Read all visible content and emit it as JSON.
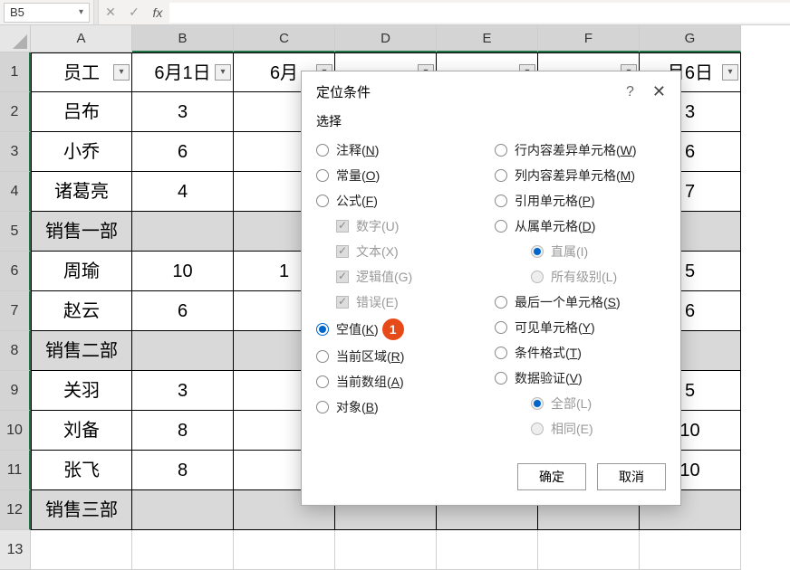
{
  "formula_bar": {
    "name_box": "B5",
    "cancel_glyph": "✕",
    "enter_glyph": "✓",
    "fx_glyph": "fx"
  },
  "columns": [
    "A",
    "B",
    "C",
    "D",
    "E",
    "F",
    "G"
  ],
  "row_headers": [
    "1",
    "2",
    "3",
    "4",
    "5",
    "6",
    "7",
    "8",
    "9",
    "10",
    "11",
    "12",
    "13"
  ],
  "selected_cols_start": 1,
  "selected_cols_end": 6,
  "rows": [
    {
      "h": "1",
      "A": "员工",
      "B": "6月1日",
      "C": "6月",
      "D": "",
      "E": "",
      "F": "",
      "G": "月6日",
      "grey": false,
      "dd": true
    },
    {
      "h": "2",
      "A": "吕布",
      "B": "3",
      "C": "",
      "D": "",
      "E": "",
      "F": "",
      "G": "3",
      "grey": false
    },
    {
      "h": "3",
      "A": "小乔",
      "B": "6",
      "C": "",
      "D": "",
      "E": "",
      "F": "",
      "G": "6",
      "grey": false
    },
    {
      "h": "4",
      "A": "诸葛亮",
      "B": "4",
      "C": "",
      "D": "",
      "E": "",
      "F": "",
      "G": "7",
      "grey": false
    },
    {
      "h": "5",
      "A": "销售一部",
      "B": "",
      "C": "",
      "D": "",
      "E": "",
      "F": "",
      "G": "",
      "grey": true
    },
    {
      "h": "6",
      "A": "周瑜",
      "B": "10",
      "C": "1",
      "D": "",
      "E": "",
      "F": "",
      "G": "5",
      "grey": false
    },
    {
      "h": "7",
      "A": "赵云",
      "B": "6",
      "C": "",
      "D": "",
      "E": "",
      "F": "",
      "G": "6",
      "grey": false
    },
    {
      "h": "8",
      "A": "销售二部",
      "B": "",
      "C": "",
      "D": "",
      "E": "",
      "F": "",
      "G": "",
      "grey": true
    },
    {
      "h": "9",
      "A": "关羽",
      "B": "3",
      "C": "",
      "D": "",
      "E": "",
      "F": "",
      "G": "5",
      "grey": false
    },
    {
      "h": "10",
      "A": "刘备",
      "B": "8",
      "C": "",
      "D": "",
      "E": "",
      "F": "",
      "G": "10",
      "grey": false
    },
    {
      "h": "11",
      "A": "张飞",
      "B": "8",
      "C": "",
      "D": "",
      "E": "",
      "F": "",
      "G": "10",
      "grey": false
    },
    {
      "h": "12",
      "A": "销售三部",
      "B": "",
      "C": "",
      "D": "",
      "E": "",
      "F": "",
      "G": "",
      "grey": true
    },
    {
      "h": "13",
      "A": "",
      "B": "",
      "C": "",
      "D": "",
      "E": "",
      "F": "",
      "G": "",
      "grey": false,
      "empty": true
    }
  ],
  "dialog": {
    "title": "定位条件",
    "help": "?",
    "close": "✕",
    "section": "选择",
    "left_options": [
      {
        "key": "comment",
        "label": "注释",
        "mn": "N",
        "type": "radio"
      },
      {
        "key": "constant",
        "label": "常量",
        "mn": "O",
        "type": "radio"
      },
      {
        "key": "formula",
        "label": "公式",
        "mn": "F",
        "type": "radio"
      },
      {
        "key": "num",
        "label": "数字(U)",
        "type": "chk",
        "indent": 1,
        "disabled": true,
        "on": true
      },
      {
        "key": "text",
        "label": "文本(X)",
        "type": "chk",
        "indent": 1,
        "disabled": true,
        "on": true
      },
      {
        "key": "logic",
        "label": "逻辑值(G)",
        "type": "chk",
        "indent": 1,
        "disabled": true,
        "on": true
      },
      {
        "key": "error",
        "label": "错误(E)",
        "type": "chk",
        "indent": 1,
        "disabled": true,
        "on": true
      },
      {
        "key": "blank",
        "label": "空值",
        "mn": "K",
        "type": "radio",
        "checked": true,
        "badge": "1"
      },
      {
        "key": "region",
        "label": "当前区域",
        "mn": "R",
        "type": "radio"
      },
      {
        "key": "array",
        "label": "当前数组",
        "mn": "A",
        "type": "radio"
      },
      {
        "key": "object",
        "label": "对象",
        "mn": "B",
        "type": "radio"
      }
    ],
    "right_options": [
      {
        "key": "rowdiff",
        "label": "行内容差异单元格",
        "mn": "W",
        "type": "radio"
      },
      {
        "key": "coldiff",
        "label": "列内容差异单元格",
        "mn": "M",
        "type": "radio"
      },
      {
        "key": "precedent",
        "label": "引用单元格",
        "mn": "P",
        "type": "radio"
      },
      {
        "key": "dependent",
        "label": "从属单元格",
        "mn": "D",
        "type": "radio"
      },
      {
        "key": "direct",
        "label": "直属(I)",
        "type": "radio",
        "indent": 2,
        "disabled": true,
        "checked": true
      },
      {
        "key": "alllvl",
        "label": "所有级别(L)",
        "type": "radio",
        "indent": 2,
        "disabled": true
      },
      {
        "key": "last",
        "label": "最后一个单元格",
        "mn": "S",
        "type": "radio"
      },
      {
        "key": "visible",
        "label": "可见单元格",
        "mn": "Y",
        "type": "radio"
      },
      {
        "key": "cond",
        "label": "条件格式",
        "mn": "T",
        "type": "radio"
      },
      {
        "key": "valid",
        "label": "数据验证",
        "mn": "V",
        "type": "radio"
      },
      {
        "key": "all",
        "label": "全部(L)",
        "type": "radio",
        "indent": 2,
        "disabled": true,
        "checked": true
      },
      {
        "key": "same",
        "label": "相同(E)",
        "type": "radio",
        "indent": 2,
        "disabled": true
      }
    ],
    "ok": "确定",
    "cancel": "取消"
  }
}
